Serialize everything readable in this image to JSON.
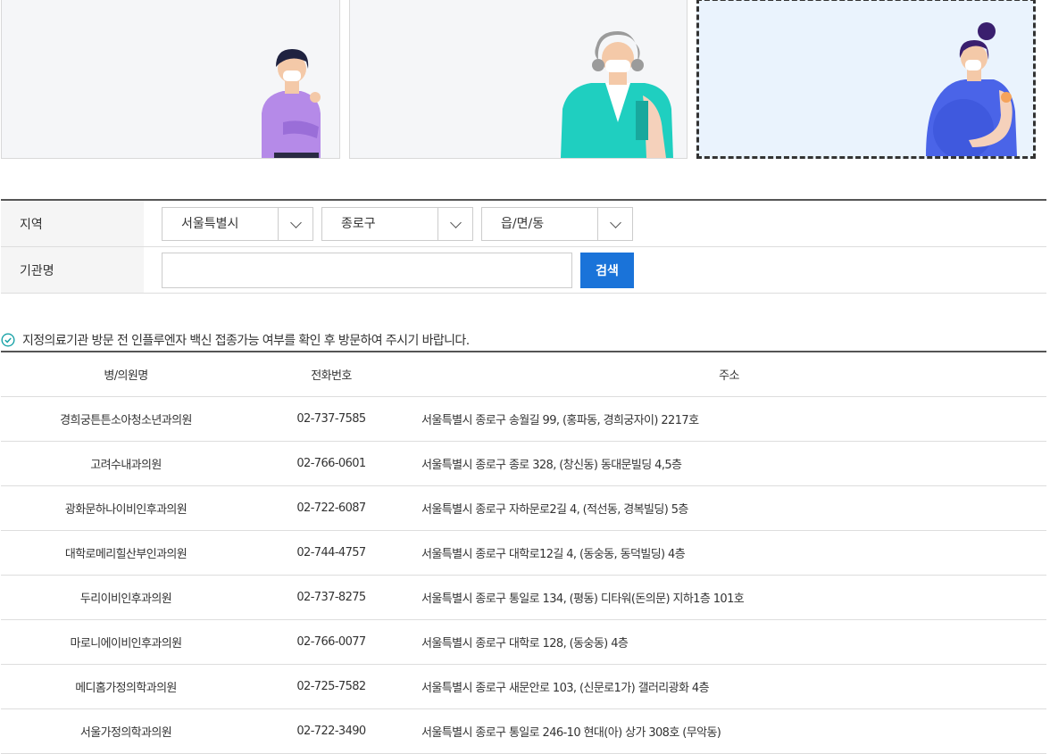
{
  "filter": {
    "region_label": "지역",
    "city_value": "서울특별시",
    "district_value": "종로구",
    "town_value": "읍/면/동",
    "institution_label": "기관명",
    "institution_value": "",
    "search_label": "검색"
  },
  "notice": {
    "text": "지정의료기관 방문 전 인플루엔자 백신 접종가능 여부를 확인 후 방문하여 주시기 바랍니다."
  },
  "table": {
    "headers": {
      "name": "병/의원명",
      "phone": "전화번호",
      "address": "주소"
    },
    "rows": [
      {
        "name": "경희궁튼튼소아청소년과의원",
        "phone": "02-737-7585",
        "address": "서울특별시 종로구 송월길 99, (홍파동, 경희궁자이) 2217호"
      },
      {
        "name": "고려수내과의원",
        "phone": "02-766-0601",
        "address": "서울특별시 종로구 종로 328, (창신동) 동대문빌딩 4,5층"
      },
      {
        "name": "광화문하나이비인후과의원",
        "phone": "02-722-6087",
        "address": "서울특별시 종로구 자하문로2길 4, (적선동, 경복빌딩) 5층"
      },
      {
        "name": "대학로메리힐산부인과의원",
        "phone": "02-744-4757",
        "address": "서울특별시 종로구 대학로12길 4, (동숭동, 동덕빌딩) 4층"
      },
      {
        "name": "두리이비인후과의원",
        "phone": "02-737-8275",
        "address": "서울특별시 종로구 통일로 134, (평동) 디타워(돈의문) 지하1층 101호"
      },
      {
        "name": "마로니에이비인후과의원",
        "phone": "02-766-0077",
        "address": "서울특별시 종로구 대학로 128, (동숭동) 4층"
      },
      {
        "name": "메디홈가정의학과의원",
        "phone": "02-725-7582",
        "address": "서울특별시 종로구 새문안로 103, (신문로1가) 갤러리광화 4층"
      },
      {
        "name": "서울가정의학과의원",
        "phone": "02-722-3490",
        "address": "서울특별시 종로구 통일로 246-10 현대(아) 상가 308호 (무악동)"
      }
    ]
  },
  "colors": {
    "accent": "#1a73d9",
    "check_icon": "#1aa3a8",
    "selected_card": "#eaf3fd"
  }
}
